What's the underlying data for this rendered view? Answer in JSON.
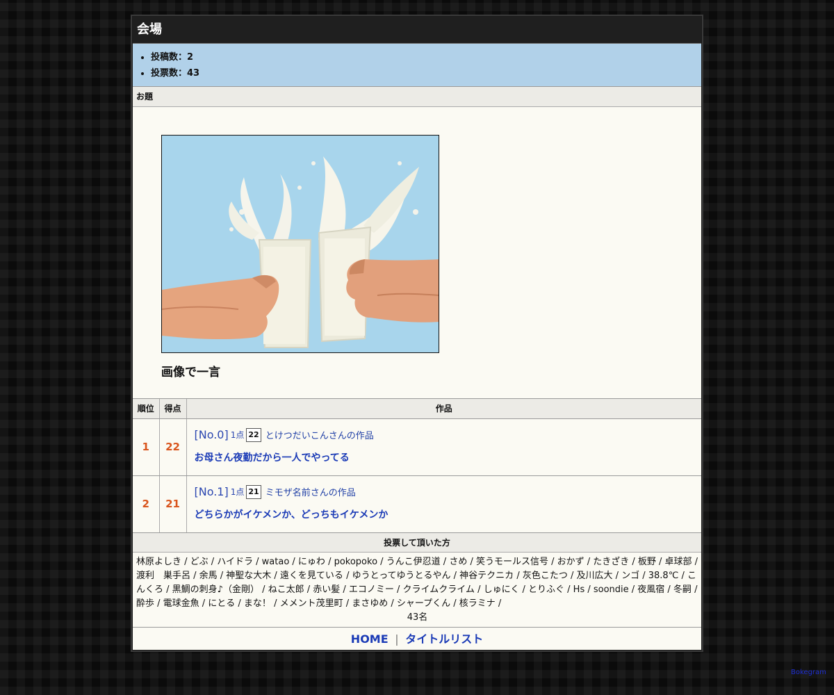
{
  "venue": {
    "title": "会場",
    "stats": [
      "投稿数：2",
      "投票数：43"
    ]
  },
  "theme": {
    "section_label": "お題",
    "caption": "画像で一言"
  },
  "ranking": {
    "headers": {
      "rank": "順位",
      "score": "得点",
      "work": "作品"
    },
    "rows": [
      {
        "rank": "1",
        "score": "22",
        "no": "[No.0]",
        "pts_label": "1点",
        "pts_value": "22",
        "author": "とけつだいこんさんの作品",
        "title": "お母さん夜勤だから一人でやってる"
      },
      {
        "rank": "2",
        "score": "21",
        "no": "[No.1]",
        "pts_label": "1点",
        "pts_value": "21",
        "author": "ミモザ名前さんの作品",
        "title": "どちらかがイケメンか、どっちもイケメンか"
      }
    ]
  },
  "voters": {
    "label": "投票して頂いた方",
    "names": "林原よしき / どぶ / ハイドラ / watao / にゅわ / pokopoko / うんこ伊忍道 / さめ / 笑うモールス信号 / おかず / たきざき / 板野 / 卓球部 / 渡利　巣手呂 / 余馬 / 神聖な大木 / 遠くを見ている / ゆうとってゆうとるやん / 神谷テクニカ / 灰色こたつ / 及川広大 / ンゴ / 38.8℃ / こんくろ / 黒鯛の刺身♪（金剛） / ねこ太郎 / 赤い髪 / エコノミー / クライムクライム / しゅにく / とりふぐ / Hs / soondie / 夜風宿 / 冬嗣 / 酔歩 / 電球金魚 / にとる / まな！ / メメント茂里町 / まさゆめ / シャープくん / 核ラミナ /",
    "count": "43名"
  },
  "footer": {
    "home": "HOME",
    "separator": "|",
    "title_list": "タイトルリスト"
  },
  "credit": "Bokegram"
}
